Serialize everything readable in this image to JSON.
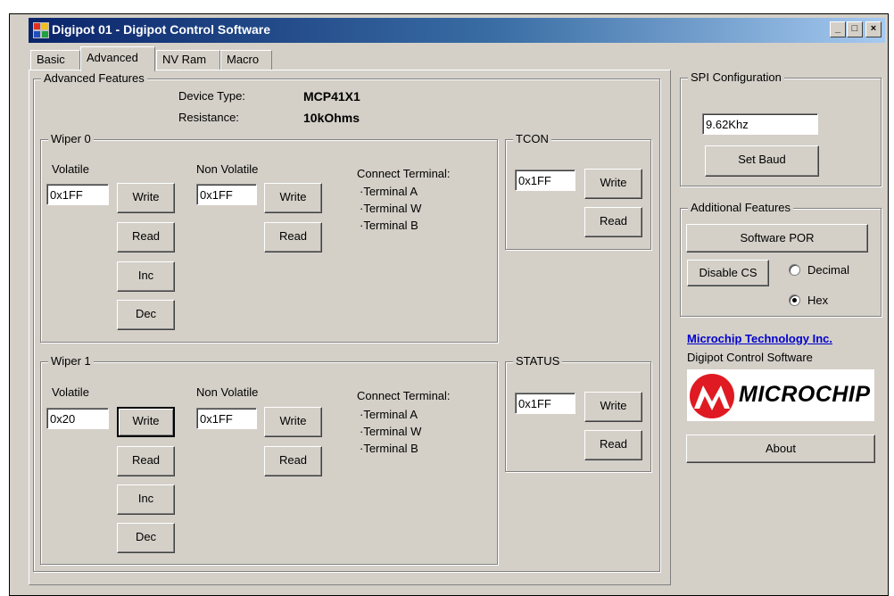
{
  "window": {
    "title": "Digipot 01 - Digipot Control Software",
    "minimize_symbol": "_",
    "maximize_symbol": "□",
    "close_symbol": "×"
  },
  "tabs": [
    "Basic",
    "Advanced",
    "NV Ram",
    "Macro"
  ],
  "advanced": {
    "group_label": "Advanced Features",
    "device_type_label": "Device Type:",
    "device_type_value": "MCP41X1",
    "resistance_label": "Resistance:",
    "resistance_value": "10kOhms"
  },
  "wipers": [
    {
      "label": "Wiper 0",
      "volatile_label": "Volatile",
      "volatile_value": "0x1FF",
      "nonvolatile_label": "Non Volatile",
      "nonvolatile_value": "0x1FF",
      "connect_label": "Connect Terminal:",
      "terminals": [
        "·Terminal A",
        "·Terminal W",
        "·Terminal B"
      ]
    },
    {
      "label": "Wiper 1",
      "volatile_label": "Volatile",
      "volatile_value": "0x20",
      "nonvolatile_label": "Non Volatile",
      "nonvolatile_value": "0x1FF",
      "connect_label": "Connect Terminal:",
      "terminals": [
        "·Terminal A",
        "·Terminal W",
        "·Terminal B"
      ]
    }
  ],
  "buttons": {
    "write": "Write",
    "read": "Read",
    "inc": "Inc",
    "dec": "Dec"
  },
  "tcon": {
    "label": "TCON",
    "value": "0x1FF"
  },
  "status": {
    "label": "STATUS",
    "value": "0x1FF"
  },
  "spi": {
    "label": "SPI Configuration",
    "baud_value": "9.62Khz",
    "set_baud_label": "Set Baud"
  },
  "additional": {
    "label": "Additional Features",
    "software_por_label": "Software POR",
    "disable_cs_label": "Disable CS",
    "decimal_label": "Decimal",
    "hex_label": "Hex",
    "selected_format": "Hex"
  },
  "about": {
    "company_link": "Microchip Technology Inc.",
    "product": "Digipot Control Software",
    "logo_text": "MICROCHIP",
    "about_button": "About"
  },
  "colors": {
    "titlebar_start": "#0a246a",
    "titlebar_end": "#a6caf0",
    "logo_red": "#e01a22",
    "link": "#0000cc"
  }
}
